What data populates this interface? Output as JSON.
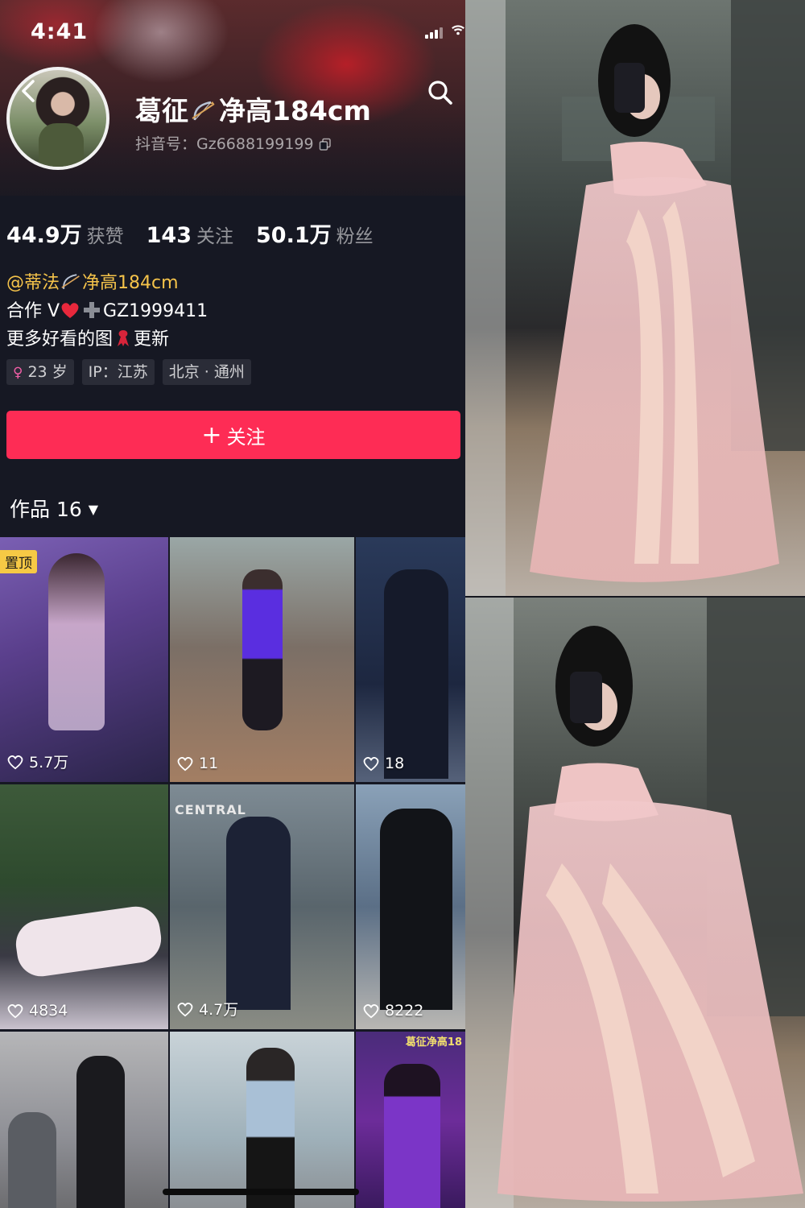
{
  "status_bar": {
    "time": "4:41"
  },
  "profile": {
    "name_part1": "葛征",
    "name_part2": "净高184cm",
    "douyin_id": "抖音号：Gz6688199199"
  },
  "stats": [
    {
      "value": "44.9万",
      "label": "获赞"
    },
    {
      "value": "143",
      "label": "关注"
    },
    {
      "value": "50.1万",
      "label": "粉丝"
    }
  ],
  "bio": {
    "mention_part1": "@蒂法",
    "mention_part2": "净高184cm",
    "line2_part1": "合作 V",
    "line2_part2": "GZ1999411",
    "line3_part1": "更多好看的图",
    "line3_part2": "更新"
  },
  "tags": {
    "age": "23 岁",
    "ip": "IP：江苏",
    "location": "北京 · 通州"
  },
  "follow_button": {
    "label": "关注"
  },
  "works": {
    "label": "作品 16"
  },
  "videos": [
    {
      "likes": "5.7万",
      "pinned_label": "置顶"
    },
    {
      "likes": "11"
    },
    {
      "likes": "18"
    },
    {
      "likes": "4834"
    },
    {
      "likes": "4.7万",
      "sign_text": "CENTRAL"
    },
    {
      "likes": "8222"
    },
    {
      "likes": ""
    },
    {
      "likes": ""
    },
    {
      "likes": "",
      "title_overlay": "葛征净高18"
    }
  ],
  "icons": [
    "back-icon",
    "search-icon",
    "copy-icon",
    "bow-icon",
    "heart-icon",
    "female-icon",
    "plus-icon",
    "caret-down-icon",
    "signal-icon",
    "wifi-icon"
  ],
  "colors": {
    "accent": "#fe2c55",
    "background": "#161823",
    "mention": "#f5c34a",
    "pin_badge": "#f6c945"
  }
}
